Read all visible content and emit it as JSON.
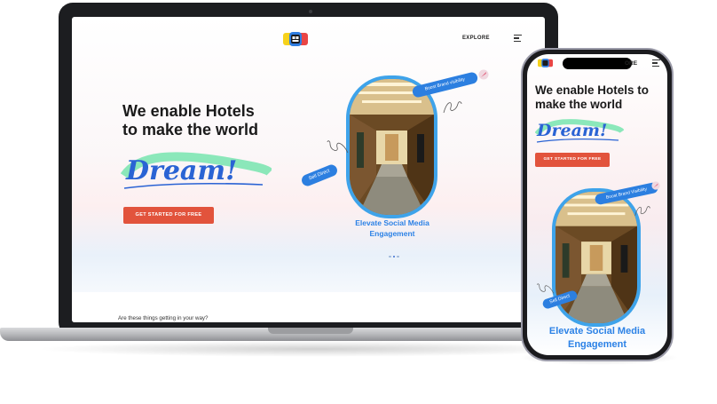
{
  "laptop": {
    "nav": {
      "explore": "EXPLORE"
    },
    "hero": {
      "headline_line1": "We enable Hotels",
      "headline_line2": "to make the world",
      "script_word": "Dream!",
      "cta": "GET STARTED FOR FREE"
    },
    "showcase": {
      "tag_boost": "Boost Brand visibility",
      "tag_sell": "Sell Direct",
      "caption_line1": "Elevate Social Media",
      "caption_line2": "Engagement"
    },
    "next_section": {
      "question": "Are these things getting in your way?"
    }
  },
  "phone": {
    "nav": {
      "explore": "ORE"
    },
    "hero": {
      "headline_line1": "We enable Hotels to",
      "headline_line2": "make the world",
      "script_word": "Dream!",
      "cta": "GET STARTED FOR FREE"
    },
    "showcase": {
      "tag_boost": "Boost Brand Visibility",
      "tag_sell": "Sell Direct",
      "caption_line1": "Elevate Social Media",
      "caption_line2": "Engagement"
    }
  },
  "colors": {
    "accent_blue": "#2c82e6",
    "cta_red": "#e2533c",
    "logo_yellow": "#f6d21c",
    "logo_red": "#e94545",
    "logo_blue": "#2f7de1"
  },
  "icons": [
    "logo-icon",
    "menu-icon",
    "rocket-icon",
    "swirl-icon"
  ]
}
